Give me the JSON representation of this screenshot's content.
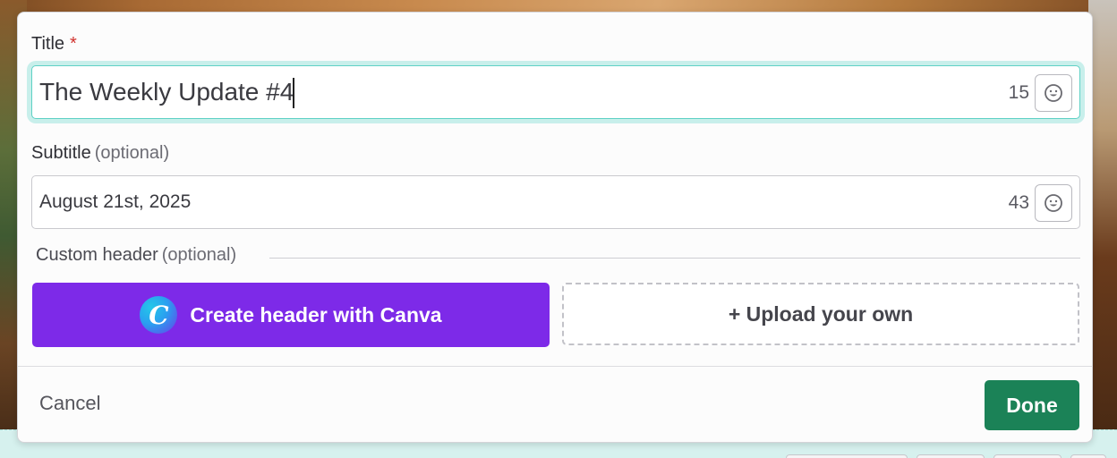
{
  "form": {
    "title": {
      "label": "Title",
      "required_mark": "*",
      "value": "The Weekly Update #4",
      "counter": "15"
    },
    "subtitle": {
      "label": "Subtitle",
      "optional_note": "(optional)",
      "value": "August 21st, 2025",
      "counter": "43"
    },
    "custom_header": {
      "label": "Custom header",
      "optional_note": "(optional)",
      "canva_button_label": "Create header with Canva",
      "canva_logo_letter": "C",
      "upload_button_label": "+ Upload your own"
    }
  },
  "footer": {
    "cancel_label": "Cancel",
    "done_label": "Done"
  },
  "colors": {
    "canva_purple": "#7d2ae8",
    "done_green": "#1b8257",
    "focus_teal": "#5fd1c5",
    "required_red": "#d0312d"
  },
  "icons": {
    "emoji": "smiley-face-icon",
    "canva": "canva-logo-icon"
  }
}
